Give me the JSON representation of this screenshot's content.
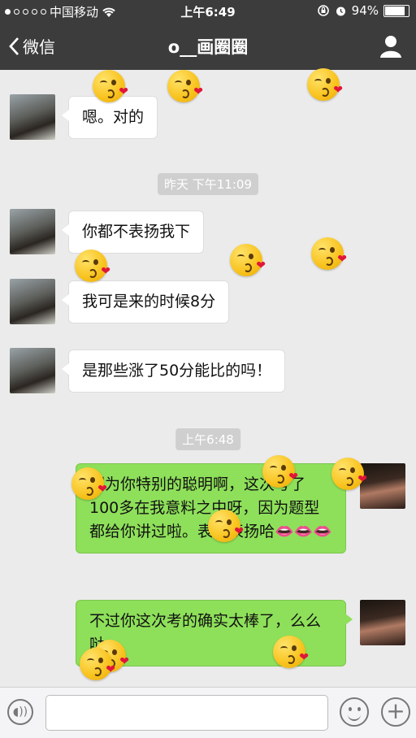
{
  "status_bar": {
    "carrier": "中国移动",
    "time": "上午6:49",
    "battery_text": "94%",
    "battery_level": 0.94,
    "signal_dots_filled": 1,
    "signal_dots_total": 5
  },
  "nav": {
    "back_label": "微信",
    "title": "o__画圈圈"
  },
  "timestamps": [
    "昨天 下午11:09",
    "上午6:48"
  ],
  "messages": [
    {
      "side": "received",
      "text": "嗯。对的"
    },
    {
      "side": "received",
      "text": "你都不表扬我下"
    },
    {
      "side": "received",
      "text": "我可是来的时候8分"
    },
    {
      "side": "received",
      "text": "是那些涨了50分能比的吗！"
    },
    {
      "side": "sent",
      "text": "因为你特别的聪明啊，这次考了100多在我意料之中呀，因为题型都给你讲过啦。表扬表扬哈👄👄👄"
    },
    {
      "side": "sent",
      "text": "不过你这次考的确实太棒了，么么哒"
    }
  ],
  "overlay_sticker": {
    "icon": "face-blowing-kiss-icon",
    "heart": "❤"
  },
  "colors": {
    "sent_bubble": "#8ee05a",
    "received_bubble": "#ffffff",
    "header": "#3c3c3c",
    "background": "#ebebeb"
  }
}
